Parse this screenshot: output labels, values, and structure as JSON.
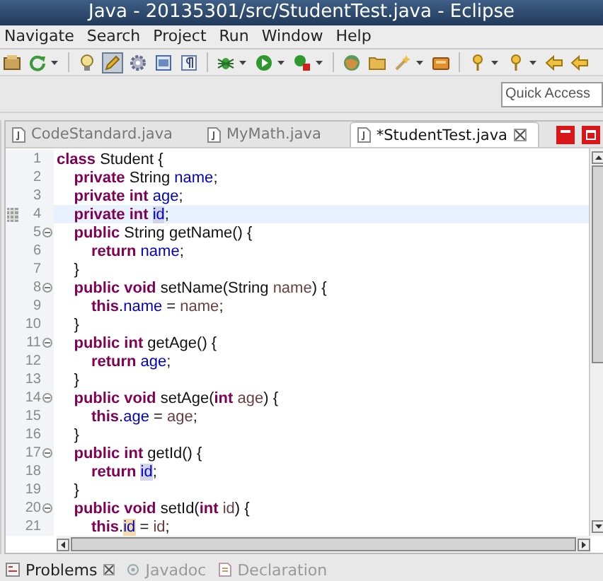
{
  "window": {
    "title": "Java - 20135301/src/StudentTest.java - Eclipse"
  },
  "menu": [
    "Navigate",
    "Search",
    "Project",
    "Run",
    "Window",
    "Help"
  ],
  "toolbar": [
    [
      {
        "kind": "package",
        "pressed": false,
        "dropdown": false
      },
      {
        "kind": "refresh",
        "pressed": false,
        "dropdown": true
      }
    ],
    [
      {
        "kind": "bulb",
        "pressed": false,
        "dropdown": false
      },
      {
        "kind": "pencil",
        "pressed": true,
        "dropdown": false
      },
      {
        "kind": "gear",
        "pressed": false,
        "dropdown": false
      },
      {
        "kind": "window",
        "pressed": false,
        "dropdown": false
      },
      {
        "kind": "pilcrow",
        "pressed": false,
        "dropdown": false
      }
    ],
    [
      {
        "kind": "bug",
        "pressed": false,
        "dropdown": true
      },
      {
        "kind": "play",
        "pressed": false,
        "dropdown": true
      },
      {
        "kind": "stop",
        "pressed": false,
        "dropdown": true
      }
    ],
    [
      {
        "kind": "globe",
        "pressed": false,
        "dropdown": false
      },
      {
        "kind": "folder",
        "pressed": false,
        "dropdown": false
      },
      {
        "kind": "wand",
        "pressed": false,
        "dropdown": true
      },
      {
        "kind": "box",
        "pressed": false,
        "dropdown": false
      }
    ],
    [
      {
        "kind": "pin",
        "pressed": false,
        "dropdown": true
      },
      {
        "kind": "pin",
        "pressed": false,
        "dropdown": true
      },
      {
        "kind": "arrow",
        "pressed": false,
        "dropdown": false
      },
      {
        "kind": "arrow",
        "pressed": false,
        "dropdown": false
      }
    ]
  ],
  "quick_access": {
    "placeholder": "Quick Access"
  },
  "editor": {
    "tabs": [
      {
        "label": "CodeStandard.java",
        "selected": false
      },
      {
        "label": "MyMath.java",
        "selected": false
      },
      {
        "label": "*StudentTest.java",
        "selected": true
      }
    ],
    "lines": [
      {
        "number": "1",
        "foldable": false,
        "current": false,
        "marker": false,
        "tokens": [
          {
            "text": "class",
            "kind": "keyword",
            "occurrence": false
          },
          {
            "text": " Student {",
            "kind": "plain",
            "occurrence": false
          }
        ]
      },
      {
        "number": "2",
        "foldable": false,
        "current": false,
        "marker": false,
        "tokens": [
          {
            "text": "    private",
            "kind": "keyword",
            "occurrence": false
          },
          {
            "text": " String ",
            "kind": "plain",
            "occurrence": false
          },
          {
            "text": "name",
            "kind": "field",
            "occurrence": false
          },
          {
            "text": ";",
            "kind": "plain",
            "occurrence": false
          }
        ]
      },
      {
        "number": "3",
        "foldable": false,
        "current": false,
        "marker": false,
        "tokens": [
          {
            "text": "    private int ",
            "kind": "keyword",
            "occurrence": false
          },
          {
            "text": "age",
            "kind": "field",
            "occurrence": false
          },
          {
            "text": ";",
            "kind": "plain",
            "occurrence": false
          }
        ]
      },
      {
        "number": "4",
        "foldable": false,
        "current": true,
        "marker": true,
        "tokens": [
          {
            "text": "    private int ",
            "kind": "keyword",
            "occurrence": false
          },
          {
            "text": "id",
            "kind": "field",
            "occurrence": true,
            "write": false
          },
          {
            "text": ";",
            "kind": "plain",
            "occurrence": false
          }
        ]
      },
      {
        "number": "5",
        "foldable": true,
        "current": false,
        "marker": false,
        "tokens": [
          {
            "text": "    public",
            "kind": "keyword",
            "occurrence": false
          },
          {
            "text": " String getName() {",
            "kind": "plain",
            "occurrence": false
          }
        ]
      },
      {
        "number": "6",
        "foldable": false,
        "current": false,
        "marker": false,
        "tokens": [
          {
            "text": "        return ",
            "kind": "keyword",
            "occurrence": false
          },
          {
            "text": "name",
            "kind": "field",
            "occurrence": false
          },
          {
            "text": ";",
            "kind": "plain",
            "occurrence": false
          }
        ]
      },
      {
        "number": "7",
        "foldable": false,
        "current": false,
        "marker": false,
        "tokens": [
          {
            "text": "    }",
            "kind": "plain",
            "occurrence": false
          }
        ]
      },
      {
        "number": "8",
        "foldable": true,
        "current": false,
        "marker": false,
        "tokens": [
          {
            "text": "    public void",
            "kind": "keyword",
            "occurrence": false
          },
          {
            "text": " setName(String ",
            "kind": "plain",
            "occurrence": false
          },
          {
            "text": "name",
            "kind": "param",
            "occurrence": false
          },
          {
            "text": ") {",
            "kind": "plain",
            "occurrence": false
          }
        ]
      },
      {
        "number": "9",
        "foldable": false,
        "current": false,
        "marker": false,
        "tokens": [
          {
            "text": "        this",
            "kind": "keyword",
            "occurrence": false
          },
          {
            "text": ".",
            "kind": "plain",
            "occurrence": false
          },
          {
            "text": "name",
            "kind": "field",
            "occurrence": false
          },
          {
            "text": " = ",
            "kind": "plain",
            "occurrence": false
          },
          {
            "text": "name",
            "kind": "param",
            "occurrence": false
          },
          {
            "text": ";",
            "kind": "plain",
            "occurrence": false
          }
        ]
      },
      {
        "number": "10",
        "foldable": false,
        "current": false,
        "marker": false,
        "tokens": [
          {
            "text": "    }",
            "kind": "plain",
            "occurrence": false
          }
        ]
      },
      {
        "number": "11",
        "foldable": true,
        "current": false,
        "marker": false,
        "tokens": [
          {
            "text": "    public int",
            "kind": "keyword",
            "occurrence": false
          },
          {
            "text": " getAge() {",
            "kind": "plain",
            "occurrence": false
          }
        ]
      },
      {
        "number": "12",
        "foldable": false,
        "current": false,
        "marker": false,
        "tokens": [
          {
            "text": "        return ",
            "kind": "keyword",
            "occurrence": false
          },
          {
            "text": "age",
            "kind": "field",
            "occurrence": false
          },
          {
            "text": ";",
            "kind": "plain",
            "occurrence": false
          }
        ]
      },
      {
        "number": "13",
        "foldable": false,
        "current": false,
        "marker": false,
        "tokens": [
          {
            "text": "    }",
            "kind": "plain",
            "occurrence": false
          }
        ]
      },
      {
        "number": "14",
        "foldable": true,
        "current": false,
        "marker": false,
        "tokens": [
          {
            "text": "    public void",
            "kind": "keyword",
            "occurrence": false
          },
          {
            "text": " setAge(",
            "kind": "plain",
            "occurrence": false
          },
          {
            "text": "int ",
            "kind": "keyword",
            "occurrence": false
          },
          {
            "text": "age",
            "kind": "param",
            "occurrence": false
          },
          {
            "text": ") {",
            "kind": "plain",
            "occurrence": false
          }
        ]
      },
      {
        "number": "15",
        "foldable": false,
        "current": false,
        "marker": false,
        "tokens": [
          {
            "text": "        this",
            "kind": "keyword",
            "occurrence": false
          },
          {
            "text": ".",
            "kind": "plain",
            "occurrence": false
          },
          {
            "text": "age",
            "kind": "field",
            "occurrence": false
          },
          {
            "text": " = ",
            "kind": "plain",
            "occurrence": false
          },
          {
            "text": "age",
            "kind": "param",
            "occurrence": false
          },
          {
            "text": ";",
            "kind": "plain",
            "occurrence": false
          }
        ]
      },
      {
        "number": "16",
        "foldable": false,
        "current": false,
        "marker": false,
        "tokens": [
          {
            "text": "    }",
            "kind": "plain",
            "occurrence": false
          }
        ]
      },
      {
        "number": "17",
        "foldable": true,
        "current": false,
        "marker": false,
        "tokens": [
          {
            "text": "    public int",
            "kind": "keyword",
            "occurrence": false
          },
          {
            "text": " getId() {",
            "kind": "plain",
            "occurrence": false
          }
        ]
      },
      {
        "number": "18",
        "foldable": false,
        "current": false,
        "marker": false,
        "tokens": [
          {
            "text": "        return ",
            "kind": "keyword",
            "occurrence": false
          },
          {
            "text": "id",
            "kind": "field",
            "occurrence": true,
            "write": false
          },
          {
            "text": ";",
            "kind": "plain",
            "occurrence": false
          }
        ]
      },
      {
        "number": "19",
        "foldable": false,
        "current": false,
        "marker": false,
        "tokens": [
          {
            "text": "    }",
            "kind": "plain",
            "occurrence": false
          }
        ]
      },
      {
        "number": "20",
        "foldable": true,
        "current": false,
        "marker": false,
        "tokens": [
          {
            "text": "    public void",
            "kind": "keyword",
            "occurrence": false
          },
          {
            "text": " setId(",
            "kind": "plain",
            "occurrence": false
          },
          {
            "text": "int ",
            "kind": "keyword",
            "occurrence": false
          },
          {
            "text": "id",
            "kind": "param",
            "occurrence": false
          },
          {
            "text": ") {",
            "kind": "plain",
            "occurrence": false
          }
        ]
      },
      {
        "number": "21",
        "foldable": false,
        "current": false,
        "marker": false,
        "tokens": [
          {
            "text": "        this",
            "kind": "keyword",
            "occurrence": false
          },
          {
            "text": ".",
            "kind": "plain",
            "occurrence": false
          },
          {
            "text": "id",
            "kind": "field",
            "occurrence": true,
            "write": true
          },
          {
            "text": " = ",
            "kind": "plain",
            "occurrence": false
          },
          {
            "text": "id",
            "kind": "param",
            "occurrence": false
          },
          {
            "text": ";",
            "kind": "plain",
            "occurrence": false
          }
        ]
      }
    ]
  },
  "bottom_tabs": [
    {
      "label": "Problems",
      "selected": true
    },
    {
      "label": "Javadoc",
      "selected": false
    },
    {
      "label": "Declaration",
      "selected": false
    }
  ]
}
